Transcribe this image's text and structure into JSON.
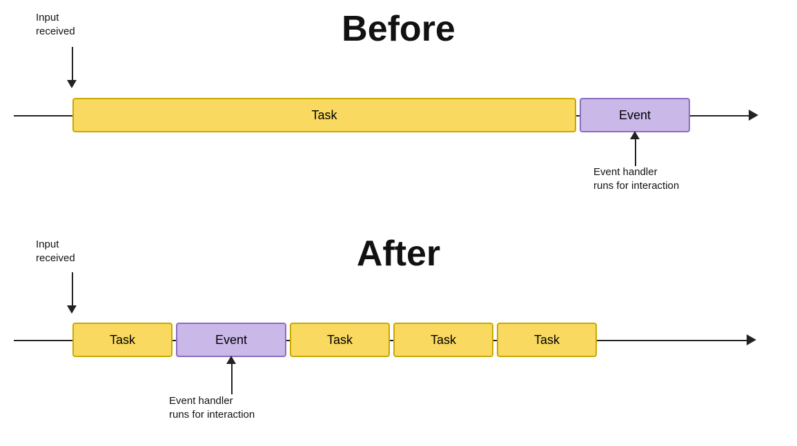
{
  "before": {
    "title": "Before",
    "input_received_label": "Input\nreceived",
    "task_label": "Task",
    "event_label": "Event",
    "event_handler_label": "Event handler\nruns for interaction"
  },
  "after": {
    "title": "After",
    "input_received_label": "Input\nreceived",
    "task_label": "Task",
    "event_label": "Event",
    "event_handler_label": "Event handler\nruns for interaction",
    "task2_label": "Task",
    "task3_label": "Task",
    "task4_label": "Task"
  }
}
